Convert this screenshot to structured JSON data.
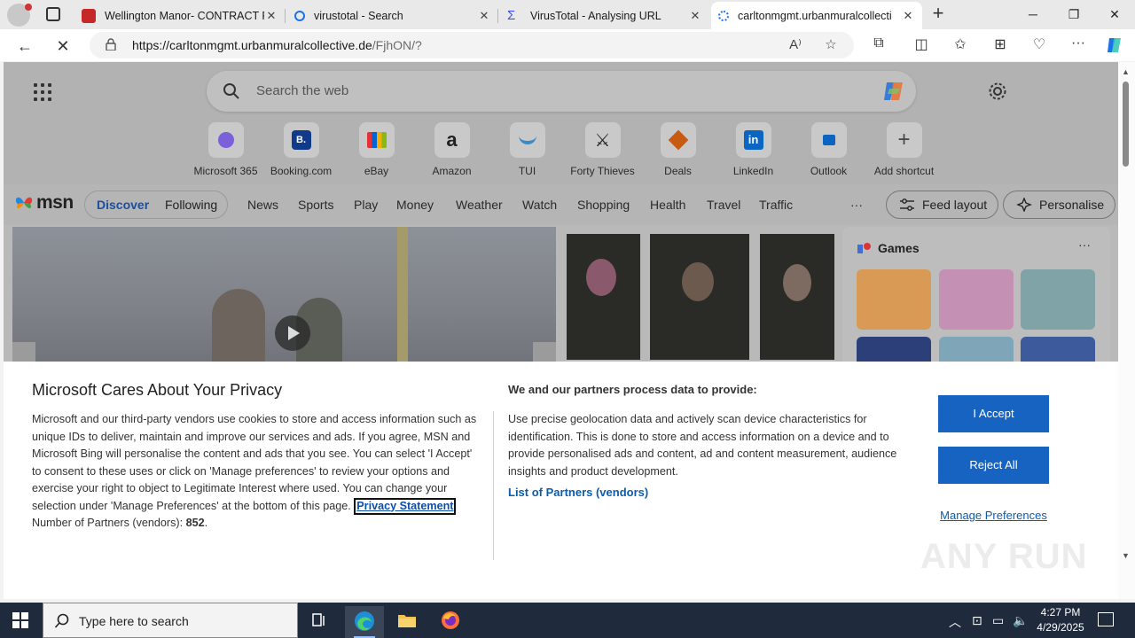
{
  "browser": {
    "tabs": [
      {
        "title": "Wellington Manor- CONTRACT P",
        "favicon": "pdf-icon",
        "color": "#c62828"
      },
      {
        "title": "virustotal - Search",
        "favicon": "search-icon",
        "color": "#1a73e8"
      },
      {
        "title": "VirusTotal - Analysing URL",
        "favicon": "virustotal-icon",
        "color": "#394eff"
      },
      {
        "title": "carltonmgmt.urbanmuralcollecti",
        "favicon": "loading-icon",
        "color": "#1a73e8"
      }
    ],
    "url_host": "https://carltonmgmt.urbanmuralcollective.de",
    "url_path": "/FjhON/?"
  },
  "newtab": {
    "search_placeholder": "Search the web",
    "shortcuts": [
      {
        "label": "Microsoft 365",
        "glyph": "",
        "color": "#6b5bd6"
      },
      {
        "label": "Booking.com",
        "glyph": "B.",
        "color": "#123a8a"
      },
      {
        "label": "eBay",
        "glyph": "",
        "color": "#e53238"
      },
      {
        "label": "Amazon",
        "glyph": "a",
        "color": "#222222"
      },
      {
        "label": "TUI",
        "glyph": "",
        "color": "#3b8ac4"
      },
      {
        "label": "Forty Thieves",
        "glyph": "",
        "color": "#222222"
      },
      {
        "label": "Deals",
        "glyph": "",
        "color": "#c75b12"
      },
      {
        "label": "LinkedIn",
        "glyph": "in",
        "color": "#0a66c2"
      },
      {
        "label": "Outlook",
        "glyph": "",
        "color": "#0a64c2"
      },
      {
        "label": "Add shortcut",
        "glyph": "+",
        "color": "#444444"
      }
    ]
  },
  "msn": {
    "logo": "msn",
    "toggle": [
      "Discover",
      "Following"
    ],
    "nav": [
      "News",
      "Sports",
      "Play",
      "Money",
      "Weather",
      "Watch",
      "Shopping",
      "Health",
      "Travel",
      "Traffic"
    ],
    "more": "···",
    "feed_layout": "Feed layout",
    "personalise": "Personalise",
    "games_title": "Games",
    "games_more": "···"
  },
  "consent": {
    "title": "Microsoft Cares About Your Privacy",
    "body": "Microsoft and our third-party vendors use cookies to store and access information such as unique IDs to deliver, maintain and improve our services and ads. If you agree, MSN and Microsoft Bing will personalise the content and ads that you see. You can select 'I Accept' to consent to these uses or click on 'Manage preferences' to review your options and exercise your right to object to Legitimate Interest where used. You can change your selection under 'Manage Preferences' at the bottom of this page.",
    "privacy_link": "Privacy Statement",
    "partners_label": "Number of Partners (vendors):",
    "partners_count": "852",
    "subtitle": "We and our partners process data to provide:",
    "purpose": "Use precise geolocation data and actively scan device characteristics for identification. This is done to store and access information on a device and to provide personalised ads and content, ad and content measurement, audience insights and product development.",
    "vendors_link": "List of Partners (vendors)",
    "accept": "I Accept",
    "reject": "Reject All",
    "manage": "Manage Preferences"
  },
  "watermark": "ANY RUN",
  "taskbar": {
    "search_placeholder": "Type here to search",
    "time": "4:27 PM",
    "date": "4/29/2025"
  }
}
